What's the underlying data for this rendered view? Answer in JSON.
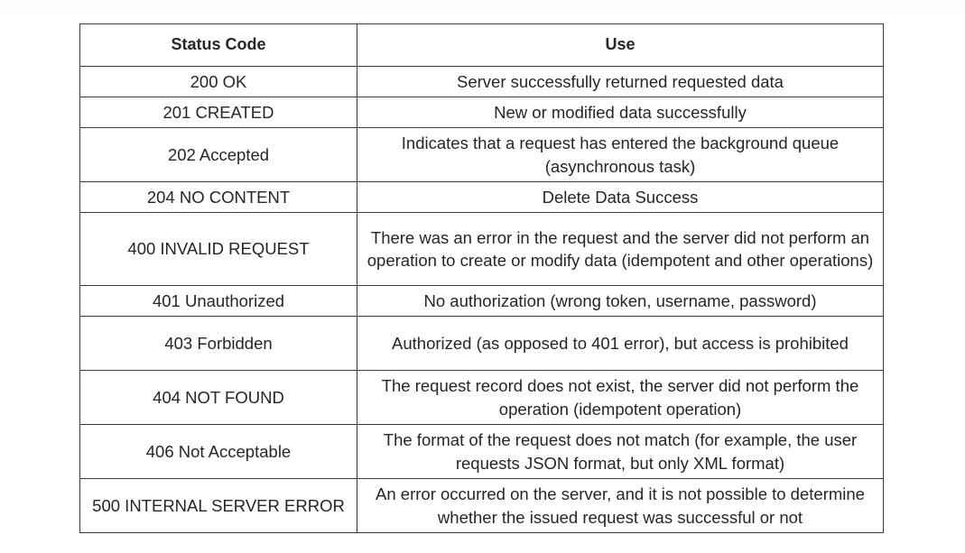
{
  "table": {
    "headers": {
      "code": "Status Code",
      "use": "Use"
    },
    "rows": [
      {
        "code": "200 OK",
        "use": "Server successfully returned requested data"
      },
      {
        "code": "201 CREATED",
        "use": "New or modified data successfully"
      },
      {
        "code": "202 Accepted",
        "use": "Indicates that a request has entered the background queue (asynchronous task)"
      },
      {
        "code": "204 NO CONTENT",
        "use": "Delete Data Success"
      },
      {
        "code": "400 INVALID REQUEST",
        "use": "There was an error in the request and the server did not perform an operation to create or modify data (idempotent and other operations)"
      },
      {
        "code": "401 Unauthorized",
        "use": "No authorization (wrong token, username, password)"
      },
      {
        "code": "403 Forbidden",
        "use": "Authorized (as opposed to 401 error), but access is prohibited"
      },
      {
        "code": "404 NOT FOUND",
        "use": "The request record does not exist, the server did not perform the operation (idempotent operation)"
      },
      {
        "code": "406 Not Acceptable",
        "use": "The format of the request does not match (for example, the user requests JSON format, but only XML format)"
      },
      {
        "code": "500 INTERNAL SERVER ERROR",
        "use": "An error occurred on the server, and it is not possible to determine whether the issued request was successful or not"
      }
    ]
  }
}
